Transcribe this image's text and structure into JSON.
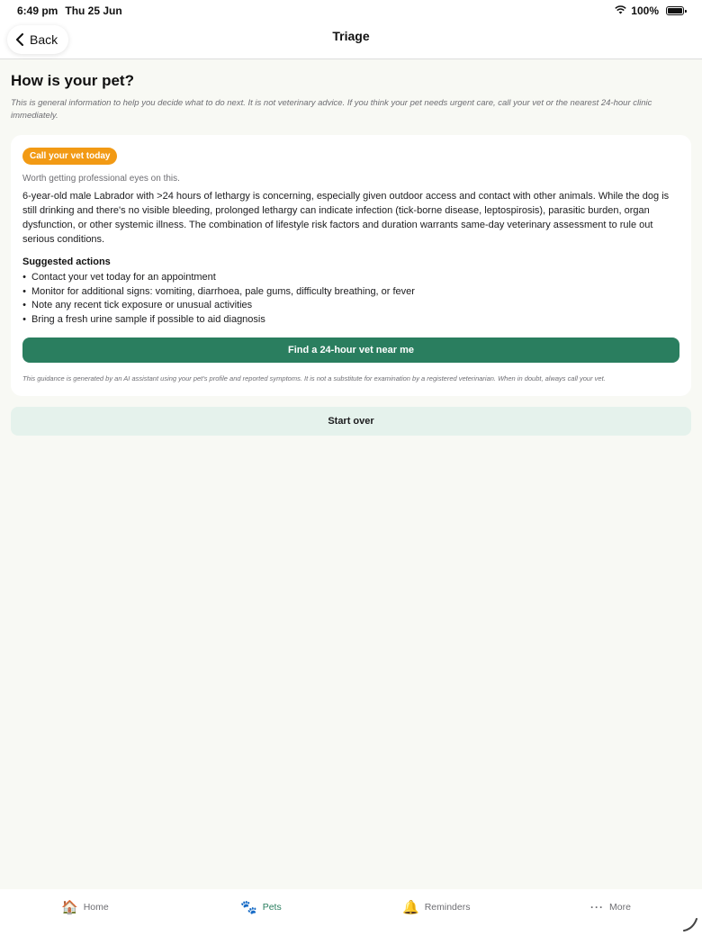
{
  "status": {
    "time": "6:49 pm",
    "date": "Thu 25 Jun",
    "battery": "100%"
  },
  "nav": {
    "back_label": "Back",
    "title": "Triage"
  },
  "page": {
    "title": "How is your pet?",
    "disclaimer": "This is general information to help you decide what to do next. It is not veterinary advice. If you think your pet needs urgent care, call your vet or the nearest 24-hour clinic immediately."
  },
  "result": {
    "badge": "Call your vet today",
    "badge_color": "#f29a14",
    "summary": "Worth getting professional eyes on this.",
    "assessment": "6-year-old male Labrador with >24 hours of lethargy is concerning, especially given outdoor access and contact with other animals. While the dog is still drinking and there's no visible bleeding, prolonged lethargy can indicate infection (tick-borne disease, leptospirosis), parasitic burden, organ dysfunction, or other systemic illness. The combination of lifestyle risk factors and duration warrants same-day veterinary assessment to rule out serious conditions.",
    "actions_heading": "Suggested actions",
    "actions": [
      "Contact your vet today for an appointment",
      "Monitor for additional signs: vomiting, diarrhoea, pale gums, difficulty breathing, or fever",
      "Note any recent tick exposure or unusual activities",
      "Bring a fresh urine sample if possible to aid diagnosis"
    ],
    "find_vet_label": "Find a 24-hour vet near me",
    "footnote": "This guidance is generated by an AI assistant using your pet's profile and reported symptoms. It is not a substitute for examination by a registered veterinarian. When in doubt, always call your vet."
  },
  "start_over_label": "Start over",
  "tabs": [
    {
      "label": "Home",
      "icon": "house-icon",
      "active": false
    },
    {
      "label": "Pets",
      "icon": "paw-icon",
      "active": true
    },
    {
      "label": "Reminders",
      "icon": "bell-icon",
      "active": false
    },
    {
      "label": "More",
      "icon": "more-icon",
      "active": false
    }
  ],
  "colors": {
    "accent": "#2a7e5f",
    "accent_light": "#e5f2ec",
    "background": "#f8f9f4"
  }
}
